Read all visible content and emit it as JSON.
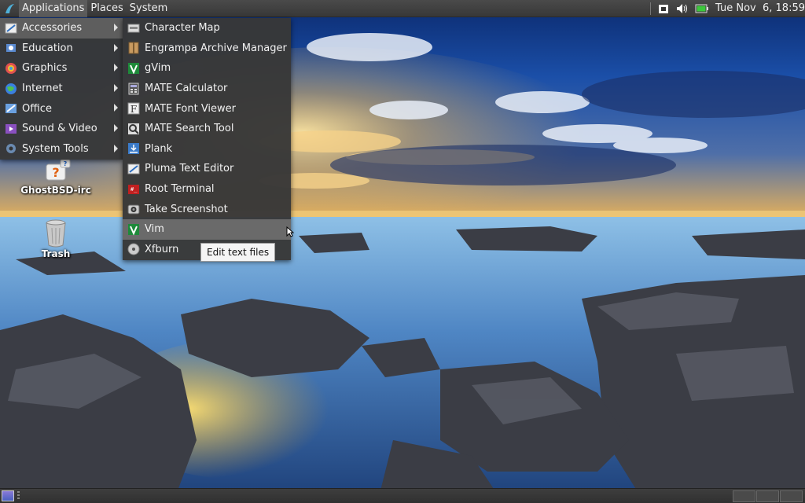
{
  "top_panel": {
    "menus": [
      "Applications",
      "Places",
      "System"
    ],
    "clock": "Tue Nov  6, 18:59",
    "tray_icons": [
      "screenshot-indicator-icon",
      "volume-icon",
      "battery-icon"
    ]
  },
  "categories": [
    {
      "label": "Accessories",
      "icon": "accessories-icon"
    },
    {
      "label": "Education",
      "icon": "education-icon"
    },
    {
      "label": "Graphics",
      "icon": "graphics-icon"
    },
    {
      "label": "Internet",
      "icon": "internet-icon"
    },
    {
      "label": "Office",
      "icon": "office-icon"
    },
    {
      "label": "Sound & Video",
      "icon": "sound-video-icon"
    },
    {
      "label": "System Tools",
      "icon": "system-tools-icon"
    }
  ],
  "accessories": [
    {
      "label": "Character Map",
      "icon": "character-map-icon"
    },
    {
      "label": "Engrampa Archive Manager",
      "icon": "archive-manager-icon"
    },
    {
      "label": "gVim",
      "icon": "gvim-icon"
    },
    {
      "label": "MATE Calculator",
      "icon": "calculator-icon"
    },
    {
      "label": "MATE Font Viewer",
      "icon": "font-viewer-icon"
    },
    {
      "label": "MATE Search Tool",
      "icon": "search-tool-icon"
    },
    {
      "label": "Plank",
      "icon": "plank-icon"
    },
    {
      "label": "Pluma Text Editor",
      "icon": "text-editor-icon"
    },
    {
      "label": "Root Terminal",
      "icon": "terminal-icon"
    },
    {
      "label": "Take Screenshot",
      "icon": "screenshot-icon"
    },
    {
      "label": "Vim",
      "icon": "vim-icon"
    },
    {
      "label": "Xfburn",
      "icon": "disc-burner-icon"
    }
  ],
  "tooltip": "Edit text files",
  "desktop_icons": [
    {
      "label": "GhostBSD-irc",
      "icon": "irc-help-icon"
    },
    {
      "label": "Trash",
      "icon": "trash-icon"
    }
  ]
}
